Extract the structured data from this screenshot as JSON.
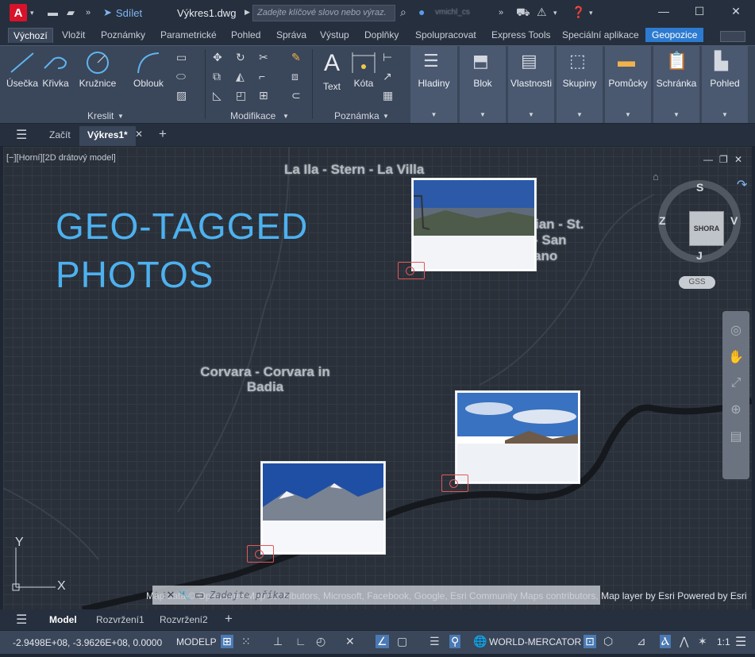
{
  "titlebar": {
    "app_letter": "A",
    "share_label": "Sdílet",
    "document_title": "Výkres1.dwg",
    "search_placeholder": "Zadejte klíčové slovo nebo výraz.",
    "user_name": "vmichl_cs"
  },
  "ribbon_tabs": [
    "Výchozí",
    "Vložit",
    "Poznámky",
    "Parametrické",
    "Pohled",
    "Správa",
    "Výstup",
    "Doplňky",
    "Spolupracovat",
    "Express Tools",
    "Speciální aplikace",
    "Geopozice"
  ],
  "ribbon": {
    "draw": {
      "line": "Úsečka",
      "polyline": "Křivka",
      "circle": "Kružnice",
      "arc": "Oblouk",
      "panel": "Kreslit"
    },
    "modify": {
      "panel": "Modifikace"
    },
    "annotation": {
      "text": "Text",
      "dimension": "Kóta",
      "panel": "Poznámka"
    },
    "groups": [
      "Hladiny",
      "Blok",
      "Vlastnosti",
      "Skupiny",
      "Pomůcky",
      "Schránka",
      "Pohled"
    ]
  },
  "doc_tabs": {
    "start": "Začít",
    "active": "Výkres1*"
  },
  "canvas": {
    "view_label": "[−][Horní][2D drátový model]",
    "title_line1": "GEO-TAGGED",
    "title_line2": "PHOTOS",
    "places": {
      "la_ila": "La Ila - Stern - La Villa",
      "san_cassiano_1": "ian - St.",
      "san_cassiano_2": "- San",
      "san_cassiano_3": "ano",
      "corvara_1": "Corvara - Corvara in",
      "corvara_2": "Badia"
    },
    "attribution": "Map data © OpenStreetMap contributors, Microsoft, Facebook, Google, Esri Community Maps contributors, Map layer by Esri Powered by Esri",
    "command_placeholder": "Zadejte příkaz",
    "viewcube": {
      "face": "SHORA",
      "north": "S",
      "south": "J",
      "east": "V",
      "west": "Z"
    },
    "gss": "GSS",
    "axis_y": "Y",
    "axis_x": "X"
  },
  "layout_tabs": [
    "Model",
    "Rozvržení1",
    "Rozvržení2"
  ],
  "status": {
    "coordinates": "-2.9498E+08, -3.9626E+08, 0.0000",
    "space": "MODELP",
    "coord_system": "WORLD-MERCATOR",
    "scale": "1:1"
  }
}
